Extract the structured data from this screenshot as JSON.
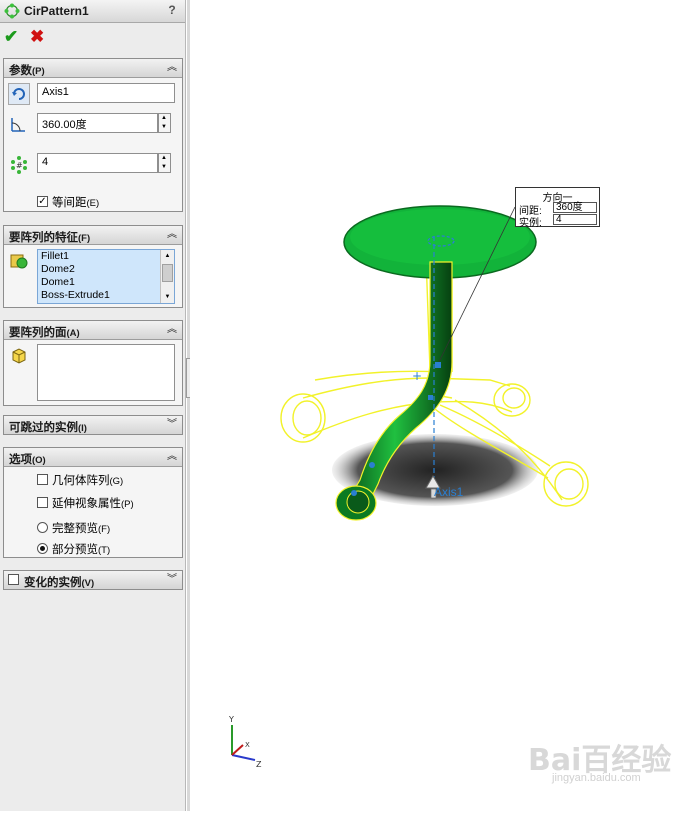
{
  "title_bar": {
    "title": "CirPattern1",
    "help": "?"
  },
  "actions": {
    "ok": "✔",
    "cancel": "✖"
  },
  "params": {
    "header": "参数",
    "header_key": "(P)",
    "axis_value": "Axis1",
    "angle_value": "360.00度",
    "count_value": "4",
    "equal_spacing_label": "等间距",
    "equal_spacing_key": "(E)",
    "equal_spacing_checked": true
  },
  "features": {
    "header": "要阵列的特征",
    "header_key": "(F)",
    "items": [
      "Fillet1",
      "Dome2",
      "Dome1",
      "Boss-Extrude1"
    ]
  },
  "faces": {
    "header": "要阵列的面",
    "header_key": "(A)"
  },
  "skip": {
    "header": "可跳过的实例",
    "header_key": "(I)"
  },
  "options": {
    "header": "选项",
    "header_key": "(O)",
    "geometry_pattern_label": "几何体阵列",
    "geometry_pattern_key": "(G)",
    "propagate_visual_label": "延伸视象属性",
    "propagate_visual_key": "(P)",
    "full_preview_label": "完整预览",
    "full_preview_key": "(F)",
    "partial_preview_label": "部分预览",
    "partial_preview_key": "(T)"
  },
  "varied": {
    "header": "变化的实例",
    "header_key": "(V)"
  },
  "callout": {
    "title": "方向一",
    "spacing_label": "间距:",
    "spacing_value": "360度",
    "instances_label": "实例:",
    "instances_value": "4"
  },
  "viewport": {
    "axis_label": "Axis1",
    "triad_x": "X",
    "triad_y": "Y",
    "triad_z": "Z"
  },
  "watermark": {
    "text": "Bai百经验",
    "sub": "jingyan.baidu.com"
  },
  "colors": {
    "model_green": "#12b33a",
    "preview_yellow": "#f2f22a",
    "axis_blue": "#2a7fd1"
  }
}
